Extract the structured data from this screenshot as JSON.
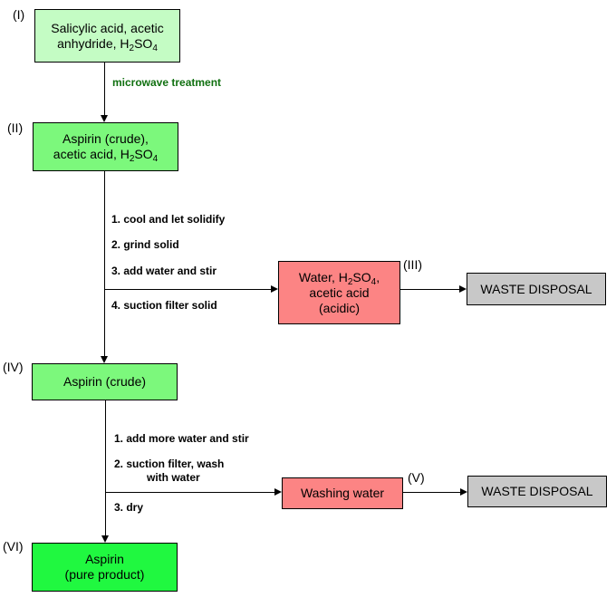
{
  "nodes": {
    "I": {
      "label": "(I)",
      "line1": "Salicylic acid, acetic",
      "line2_pre": "anhydride, H",
      "sub1": "2",
      "mid": "SO",
      "sub2": "4"
    },
    "II": {
      "label": "(II)",
      "line1": "Aspirin (crude),",
      "line2_pre": "acetic acid, H",
      "sub1": "2",
      "mid": "SO",
      "sub2": "4"
    },
    "III": {
      "label": "(III)",
      "line1_pre": "Water, H",
      "sub1": "2",
      "mid": "SO",
      "sub2": "4",
      "line1_post": ",",
      "line2": "acetic acid",
      "line3": "(acidic)"
    },
    "IV": {
      "label": "(IV)",
      "text": "Aspirin (crude)"
    },
    "V": {
      "label": "(V)",
      "text": "Washing water"
    },
    "VI": {
      "label": "(VI)",
      "line1": "Aspirin",
      "line2": "(pure product)"
    },
    "waste1": {
      "text": "WASTE DISPOSAL"
    },
    "waste2": {
      "text": "WASTE DISPOSAL"
    }
  },
  "edges": {
    "I_II": "microwave treatment",
    "II_steps": [
      "1. cool and let solidify",
      "2. grind solid",
      "3. add water and stir",
      "4. suction filter solid"
    ],
    "IV_steps": [
      "1. add more water and stir",
      "2. suction filter, wash",
      "with water",
      "3. dry"
    ]
  },
  "colors": {
    "start": "#c4fcc4",
    "intermediate": "#7cf87c",
    "product": "#20f840",
    "acidic": "#fc8484",
    "waste": "#c8c8c8",
    "annotation": "#107010"
  }
}
